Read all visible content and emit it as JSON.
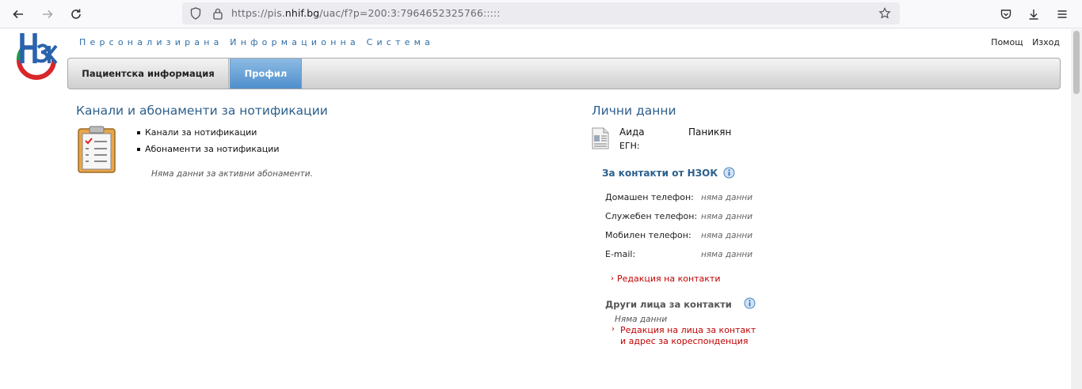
{
  "browser": {
    "url_prefix": "https://pis.",
    "url_domain": "nhif.bg",
    "url_suffix": "/uac/f?p=200:3:7964652325766:::::"
  },
  "header": {
    "system_title": "Персонализирана Информационна Система",
    "help_link": "Помощ",
    "exit_link": "Изход"
  },
  "tabs": [
    {
      "label": "Пациентска информация",
      "active": false
    },
    {
      "label": "Профил",
      "active": true
    }
  ],
  "notifications": {
    "title": "Канали и абонаменти за нотификации",
    "items": [
      "Канали за нотификации",
      "Абонаменти за нотификации"
    ],
    "empty_note": "Няма данни за активни абонаменти."
  },
  "personal": {
    "title": "Лични данни",
    "first_name": "Аида",
    "last_name": "Паникян",
    "egn_label": "ЕГН:",
    "contacts_title": "За контакти от НЗОК",
    "contacts": [
      {
        "label": "Домашен телефон:",
        "value": "няма данни"
      },
      {
        "label": "Служебен телефон:",
        "value": "няма данни"
      },
      {
        "label": "Мобилен телефон:",
        "value": "няма данни"
      },
      {
        "label": "E-mail:",
        "value": "няма данни"
      }
    ],
    "edit_contacts_link": "Редакция на контакти",
    "other_persons_title": "Други лица за контакти",
    "other_persons_empty": "Няма данни",
    "edit_persons_link_line1": "Редакция на лица за контакт",
    "edit_persons_link_line2": "и адрес за кореспонденция"
  },
  "colors": {
    "accent_blue": "#2c5f8c",
    "link_red": "#c00000",
    "active_tab": "#5a98d2"
  }
}
